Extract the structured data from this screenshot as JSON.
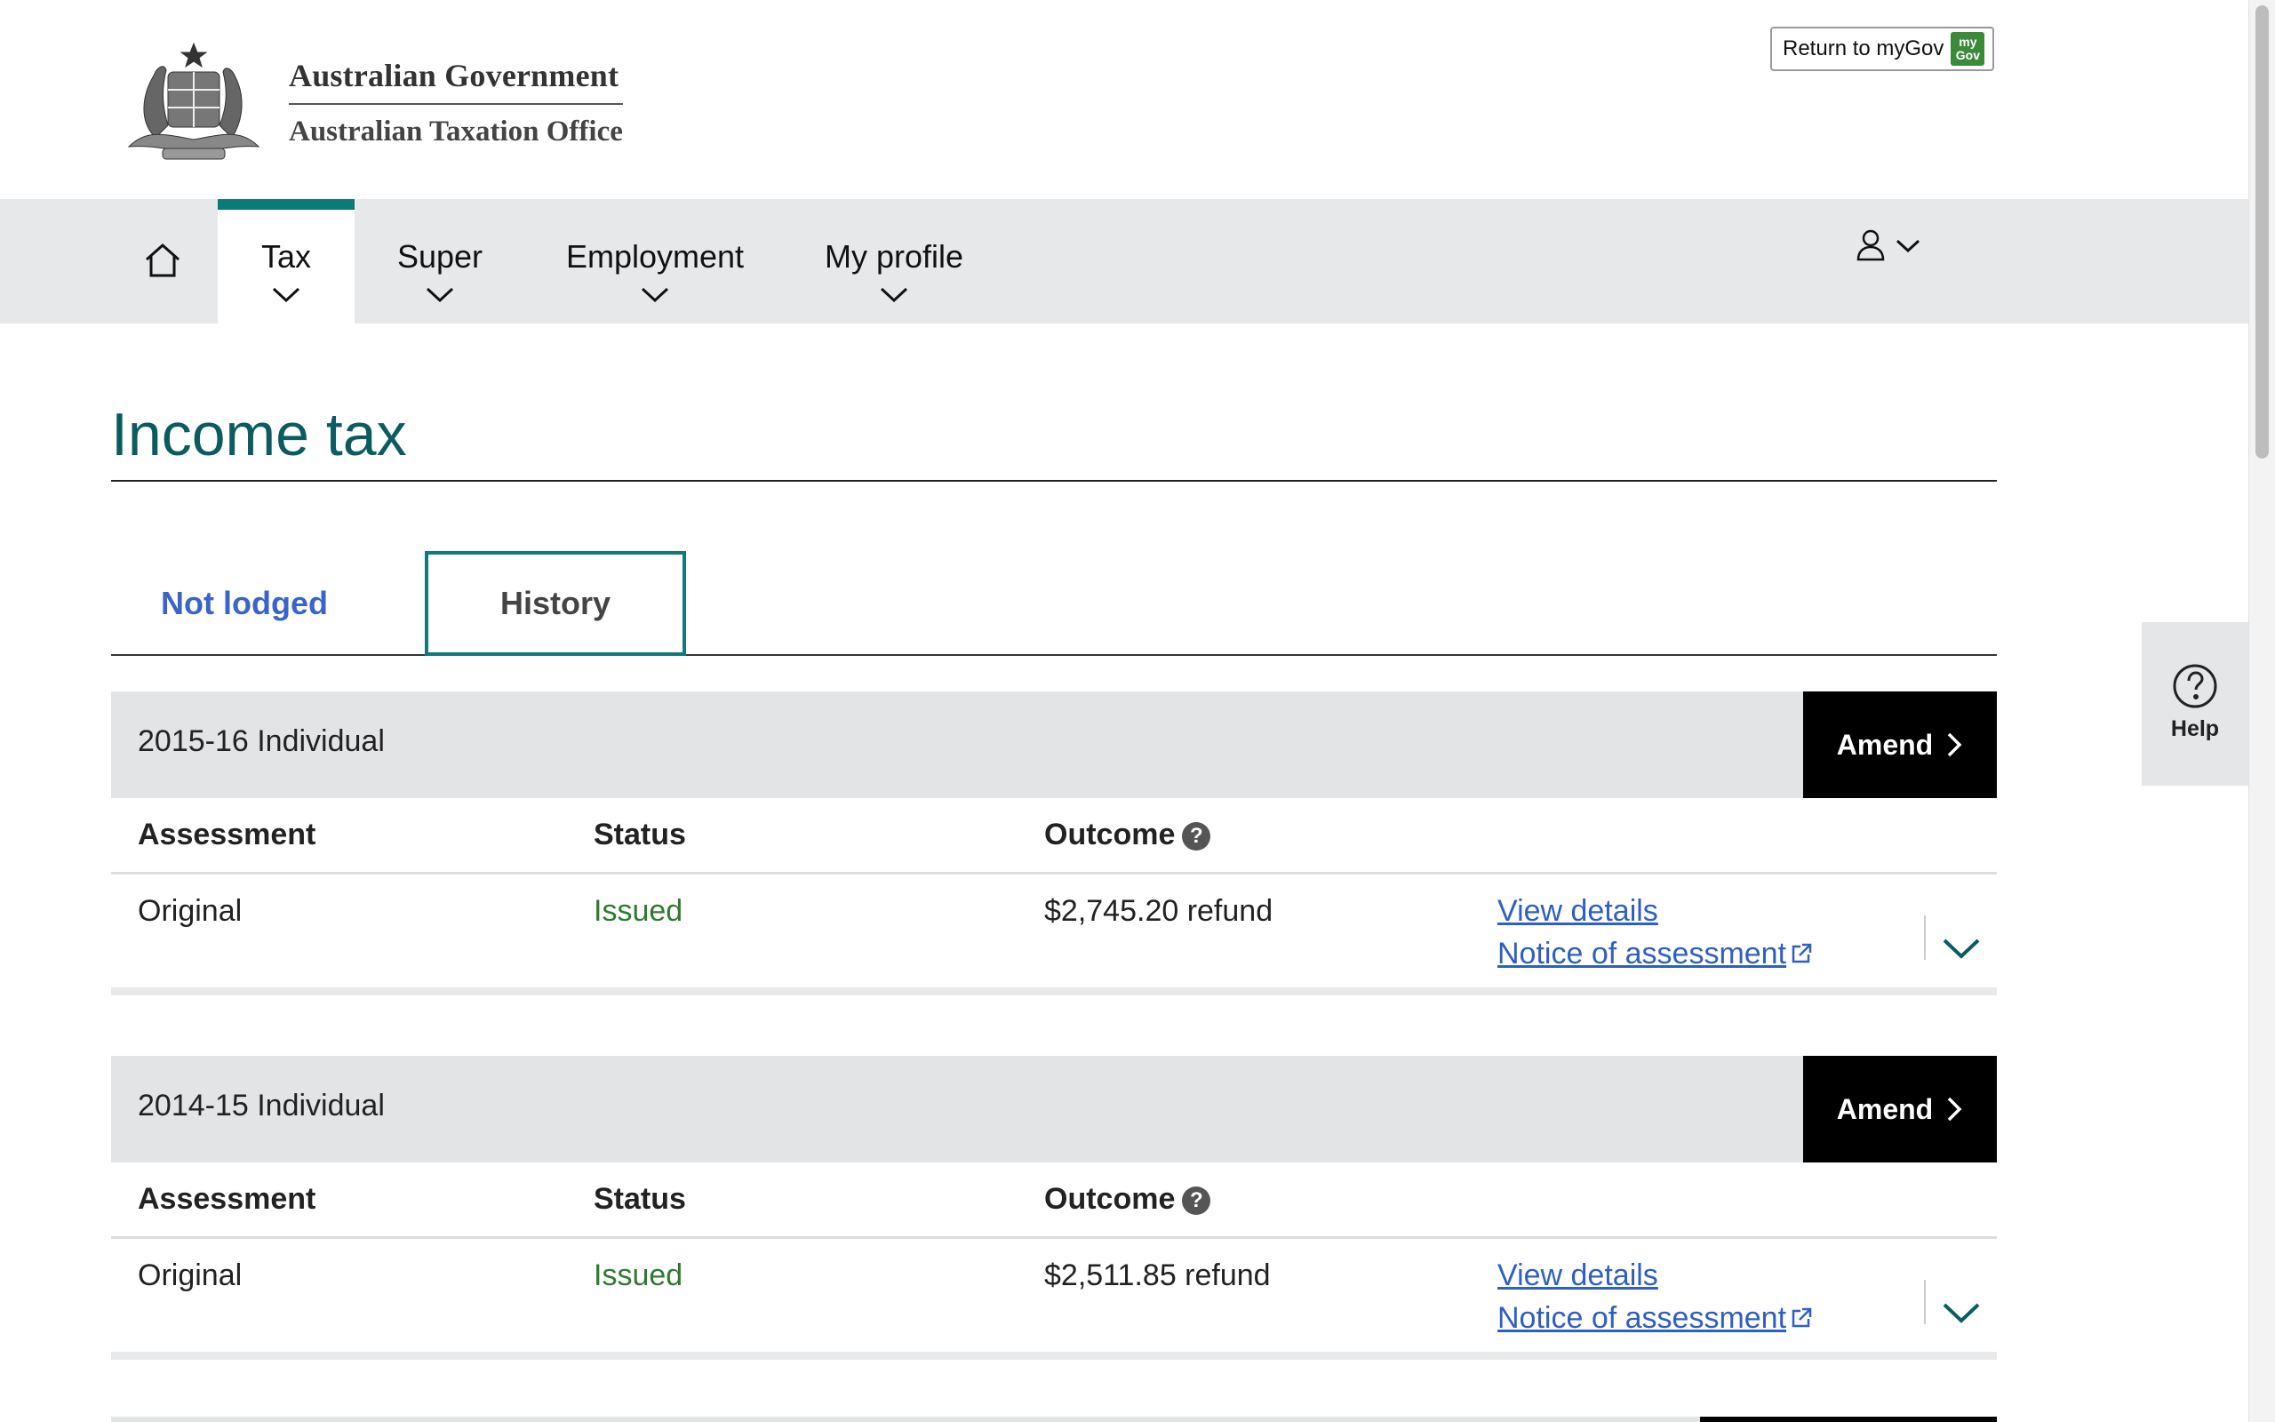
{
  "header": {
    "agency_line1": "Australian Government",
    "agency_line2": "Australian Taxation Office",
    "return_button": "Return to myGov",
    "mygov_logo_text": "my Gov"
  },
  "nav": {
    "items": [
      {
        "label": "Tax",
        "active": true
      },
      {
        "label": "Super",
        "active": false
      },
      {
        "label": "Employment",
        "active": false
      },
      {
        "label": "My profile",
        "active": false
      }
    ],
    "icons": [
      "home-icon",
      "user-icon",
      "chevron-down-icon"
    ]
  },
  "main": {
    "title": "Income tax",
    "tabs": [
      {
        "label": "Not lodged",
        "active": false
      },
      {
        "label": "History",
        "active": true
      }
    ],
    "columns": {
      "assessment": "Assessment",
      "status": "Status",
      "outcome": "Outcome",
      "outcome_help": "?"
    },
    "years": [
      {
        "label": "2015-16 Individual",
        "amend": "Amend",
        "assessment": "Original",
        "status": "Issued",
        "outcome": "$2,745.20 refund",
        "view_details": "View details",
        "notice": "Notice of assessment"
      },
      {
        "label": "2014-15 Individual",
        "amend": "Amend",
        "assessment": "Original",
        "status": "Issued",
        "outcome": "$2,511.85 refund",
        "view_details": "View details",
        "notice": "Notice of assessment"
      }
    ]
  },
  "help": {
    "label": "Help",
    "icon": "question-circle-icon"
  },
  "colors": {
    "accent_teal": "#0c7a76",
    "title_teal": "#0b5c60",
    "link_blue": "#2f5fc4",
    "status_green": "#2f7a2f",
    "nav_bg": "#e7e8ea"
  }
}
